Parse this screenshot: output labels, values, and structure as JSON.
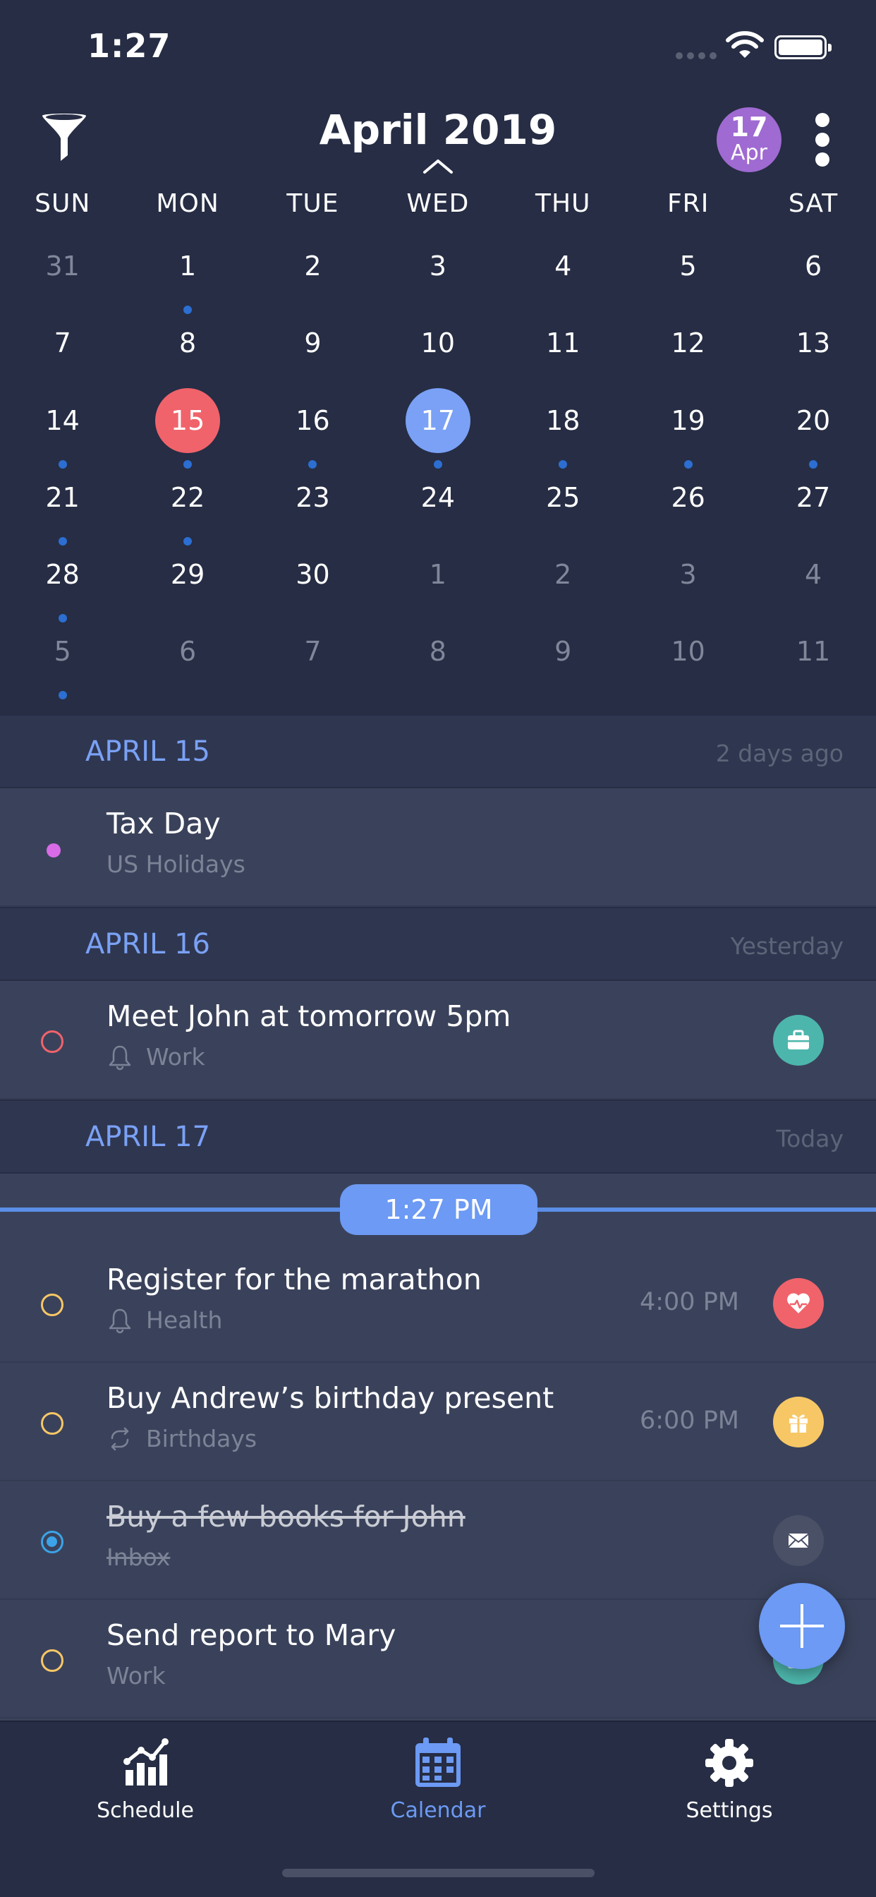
{
  "status_bar": {
    "time": "1:27"
  },
  "header": {
    "month_title": "April 2019",
    "today_badge": {
      "day": "17",
      "month": "Apr"
    }
  },
  "weekdays": [
    "SUN",
    "MON",
    "TUE",
    "WED",
    "THU",
    "FRI",
    "SAT"
  ],
  "calendar_days": [
    {
      "d": "31",
      "muted": true,
      "dot": false
    },
    {
      "d": "1",
      "muted": false,
      "dot": true
    },
    {
      "d": "2",
      "muted": false,
      "dot": false
    },
    {
      "d": "3",
      "muted": false,
      "dot": false
    },
    {
      "d": "4",
      "muted": false,
      "dot": false
    },
    {
      "d": "5",
      "muted": false,
      "dot": false
    },
    {
      "d": "6",
      "muted": false,
      "dot": false
    },
    {
      "d": "7",
      "muted": false,
      "dot": false
    },
    {
      "d": "8",
      "muted": false,
      "dot": false
    },
    {
      "d": "9",
      "muted": false,
      "dot": false
    },
    {
      "d": "10",
      "muted": false,
      "dot": false
    },
    {
      "d": "11",
      "muted": false,
      "dot": false
    },
    {
      "d": "12",
      "muted": false,
      "dot": false
    },
    {
      "d": "13",
      "muted": false,
      "dot": false
    },
    {
      "d": "14",
      "muted": false,
      "dot": true
    },
    {
      "d": "15",
      "muted": false,
      "dot": true,
      "state": "selected"
    },
    {
      "d": "16",
      "muted": false,
      "dot": true
    },
    {
      "d": "17",
      "muted": false,
      "dot": true,
      "state": "today"
    },
    {
      "d": "18",
      "muted": false,
      "dot": true
    },
    {
      "d": "19",
      "muted": false,
      "dot": true
    },
    {
      "d": "20",
      "muted": false,
      "dot": true
    },
    {
      "d": "21",
      "muted": false,
      "dot": true
    },
    {
      "d": "22",
      "muted": false,
      "dot": true
    },
    {
      "d": "23",
      "muted": false,
      "dot": false
    },
    {
      "d": "24",
      "muted": false,
      "dot": false
    },
    {
      "d": "25",
      "muted": false,
      "dot": false
    },
    {
      "d": "26",
      "muted": false,
      "dot": false
    },
    {
      "d": "27",
      "muted": false,
      "dot": false
    },
    {
      "d": "28",
      "muted": false,
      "dot": true
    },
    {
      "d": "29",
      "muted": false,
      "dot": false
    },
    {
      "d": "30",
      "muted": false,
      "dot": false
    },
    {
      "d": "1",
      "muted": true,
      "dot": false
    },
    {
      "d": "2",
      "muted": true,
      "dot": false
    },
    {
      "d": "3",
      "muted": true,
      "dot": false
    },
    {
      "d": "4",
      "muted": true,
      "dot": false
    },
    {
      "d": "5",
      "muted": true,
      "dot": true
    },
    {
      "d": "6",
      "muted": true,
      "dot": false
    },
    {
      "d": "7",
      "muted": true,
      "dot": false
    },
    {
      "d": "8",
      "muted": true,
      "dot": false
    },
    {
      "d": "9",
      "muted": true,
      "dot": false
    },
    {
      "d": "10",
      "muted": true,
      "dot": false
    },
    {
      "d": "11",
      "muted": true,
      "dot": false
    }
  ],
  "sections": {
    "apr15": {
      "label": "APRIL 15",
      "relative": "2 days ago"
    },
    "apr16": {
      "label": "APRIL 16",
      "relative": "Yesterday"
    },
    "apr17": {
      "label": "APRIL 17",
      "relative": "Today"
    }
  },
  "events": {
    "tax_day": {
      "title": "Tax Day",
      "subtitle": "US Holidays",
      "dot_color": "#d96be6",
      "icon": "none"
    },
    "meet_john": {
      "title": "Meet John at tomorrow 5pm",
      "subtitle": "Work",
      "sub_icon": "bell-icon",
      "category_icon": "briefcase-icon",
      "category_color": "#4db6ac"
    },
    "marathon": {
      "title": "Register for the marathon",
      "subtitle": "Health",
      "sub_icon": "bell-icon",
      "time": "4:00 PM",
      "category_icon": "heart-pulse-icon",
      "category_color": "#f0636b"
    },
    "birthday": {
      "title": "Buy Andrew’s birthday present",
      "subtitle": "Birthdays",
      "sub_icon": "repeat-icon",
      "time": "6:00 PM",
      "category_icon": "gift-icon",
      "category_color": "#f7c766"
    },
    "books": {
      "title": "Buy a few books for John",
      "subtitle": "Inbox",
      "completed": true,
      "category_icon": "envelope-icon",
      "category_color": "#4a5066"
    },
    "report": {
      "title": "Send report to Mary",
      "subtitle": "Work",
      "category_icon": "briefcase-icon",
      "category_color": "#4db6ac"
    }
  },
  "now_indicator": {
    "time": "1:27 PM"
  },
  "tabbar": {
    "schedule": "Schedule",
    "calendar": "Calendar",
    "settings": "Settings",
    "active": "calendar",
    "accent": "#6c9af4"
  }
}
